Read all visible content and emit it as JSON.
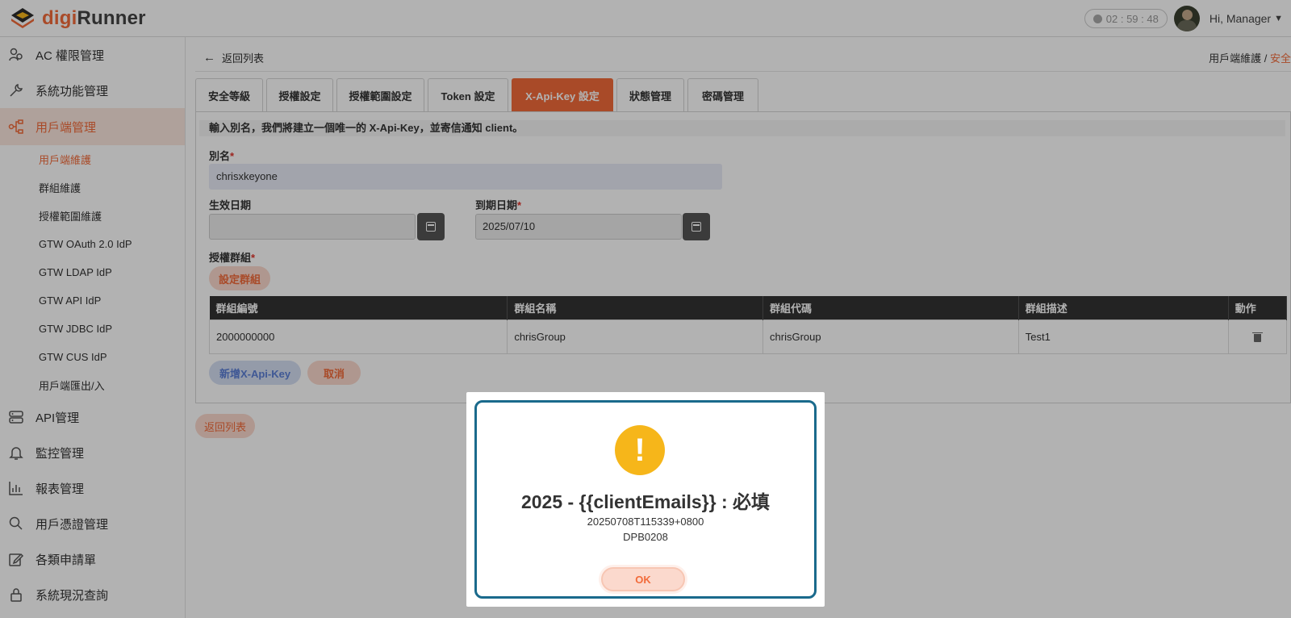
{
  "header": {
    "brand_digi": "digi",
    "brand_runner": "Runner",
    "timer": "02 : 59 : 48",
    "greeting": "Hi, Manager"
  },
  "sidebar": {
    "items": [
      {
        "label": "AC 權限管理",
        "icon": "users-icon"
      },
      {
        "label": "系統功能管理",
        "icon": "wrench-icon"
      },
      {
        "label": "用戶端管理",
        "icon": "network-icon",
        "active": true
      },
      {
        "label": "API管理",
        "icon": "server-icon"
      },
      {
        "label": "監控管理",
        "icon": "bell-icon"
      },
      {
        "label": "報表管理",
        "icon": "bar-chart-icon"
      },
      {
        "label": "用戶憑證管理",
        "icon": "search-icon"
      },
      {
        "label": "各類申請單",
        "icon": "edit-icon"
      },
      {
        "label": "系統現況查詢",
        "icon": "lock-icon"
      }
    ],
    "sub_items": [
      {
        "label": "用戶端維護",
        "active": true
      },
      {
        "label": "群組維護"
      },
      {
        "label": "授權範圍維護"
      },
      {
        "label": "GTW OAuth 2.0 IdP"
      },
      {
        "label": "GTW LDAP IdP"
      },
      {
        "label": "GTW API IdP"
      },
      {
        "label": "GTW JDBC IdP"
      },
      {
        "label": "GTW CUS IdP"
      },
      {
        "label": "用戶端匯出/入"
      }
    ]
  },
  "main": {
    "back_link": "返回列表",
    "breadcrumb_parent": "用戶端維護",
    "breadcrumb_sep": " / ",
    "breadcrumb_current": "安全",
    "tabs": [
      {
        "label": "安全等級"
      },
      {
        "label": "授權設定"
      },
      {
        "label": "授權範圍設定"
      },
      {
        "label": "Token 設定"
      },
      {
        "label": "X-Api-Key 設定",
        "active": true
      },
      {
        "label": "狀態管理"
      },
      {
        "label": "密碼管理"
      }
    ],
    "notice": "輸入別名，我們將建立一個唯一的 X-Api-Key，並寄信通知 client。",
    "alias_label": "別名",
    "alias_value": "chrisxkeyone",
    "effective_date_label": "生效日期",
    "effective_date_value": "",
    "expiry_date_label": "到期日期",
    "expiry_date_value": "2025/07/10",
    "auth_group_label": "授權群組",
    "set_group_button": "設定群組",
    "table": {
      "headers": [
        "群組編號",
        "群組名稱",
        "群組代碼",
        "群組描述",
        "動作"
      ],
      "rows": [
        [
          "2000000000",
          "chrisGroup",
          "chrisGroup",
          "Test1"
        ]
      ]
    },
    "add_button": "新增X-Api-Key",
    "cancel_button": "取消",
    "bottom_back_button": "返回列表"
  },
  "modal": {
    "title": "2025 - {{clientEmails}} : 必填",
    "timestamp": "20250708T115339+0800",
    "code": "DPB0208",
    "ok_button": "OK"
  },
  "colors": {
    "accent": "#f26b3a",
    "warning": "#f6b61a",
    "modal_border": "#1a6a8c"
  }
}
